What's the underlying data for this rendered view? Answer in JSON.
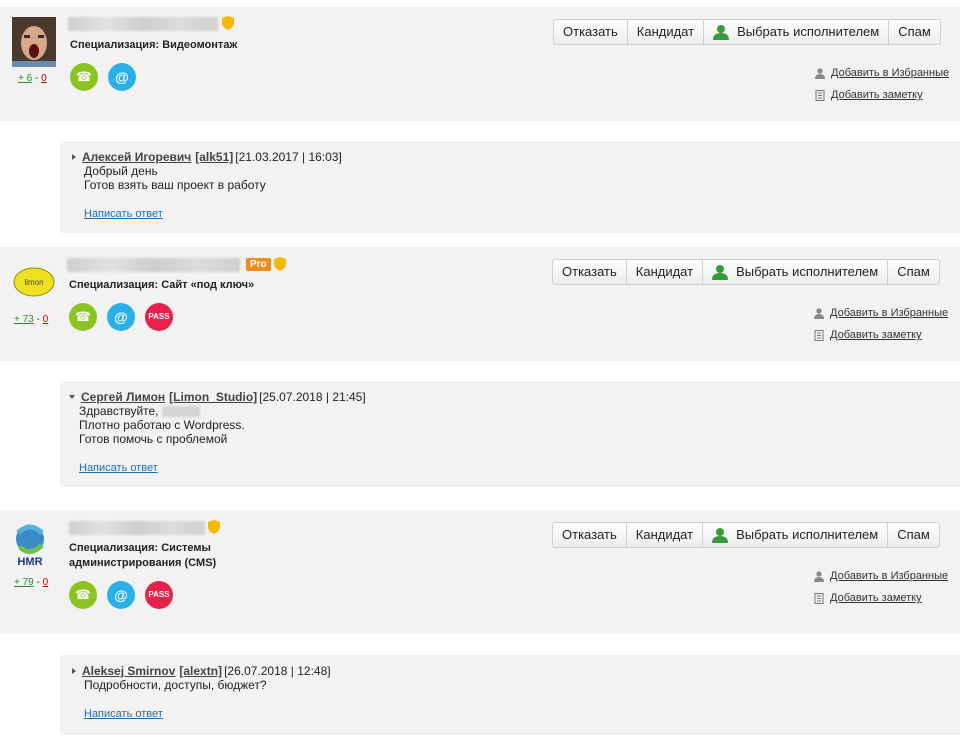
{
  "common": {
    "buttons": {
      "reject": "Отказать",
      "candidate": "Кандидат",
      "choose": "Выбрать исполнителем",
      "spam": "Спам"
    },
    "add_favorites": "Добавить в Избранные",
    "add_note": "Добавить заметку",
    "reply": "Написать ответ",
    "pro_badge": "Pro",
    "pass_label": "PASS",
    "phone_icon": "☎",
    "mail_icon": "@",
    "colors": {
      "phone": "#8bc31f",
      "mail": "#2ab0e8",
      "pass": "#e8214b",
      "pro": "#f08c1e",
      "link": "#1a6fb0"
    }
  },
  "offers": [
    {
      "rating_plus": "+ 6",
      "rating_sep": "-",
      "rating_minus": "0",
      "spec": "Специализация: Видеомонтаж",
      "comment": {
        "author": "Алексей Игоревич",
        "login": "[alk51]",
        "date": "[21.03.2017 | 16:03]",
        "lines": [
          "Добрый день",
          "Готов взять ваш проект в работу"
        ]
      }
    },
    {
      "rating_plus": "+ 73",
      "rating_sep": "-",
      "rating_minus": "0",
      "spec": "Специализация: Сайт «под ключ»",
      "comment": {
        "author": "Сергей Лимон",
        "login": "[Limon_Studio]",
        "date": "[25.07.2018 | 21:45]",
        "lines": [
          "Здравствуйте,",
          "Плотно работаю с Wordpress.",
          "Готов помочь с проблемой"
        ]
      }
    },
    {
      "rating_plus": "+ 79",
      "rating_sep": "-",
      "rating_minus": "0",
      "spec_line1": "Специализация: Системы",
      "spec_line2": "администрирования (CMS)",
      "comment": {
        "author": "Aleksej Smirnov",
        "login": "[alextn]",
        "date": "[26.07.2018 | 12:48]",
        "lines": [
          "Подробности, доступы, бюджет?"
        ]
      }
    }
  ]
}
